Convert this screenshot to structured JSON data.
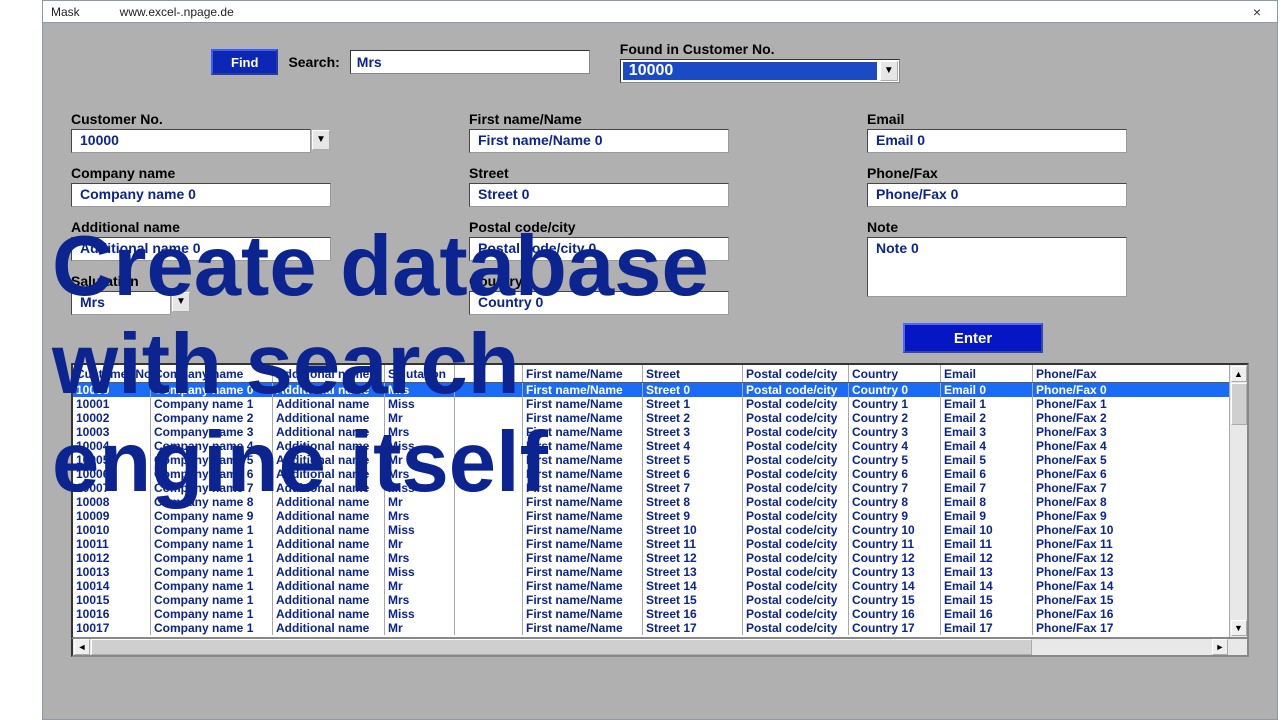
{
  "window": {
    "title": "Mask",
    "url": "www.excel-.npage.de",
    "close_glyph": "×"
  },
  "toolbar": {
    "find_label": "Find",
    "search_label": "Search:",
    "search_value": "Mrs",
    "found_label": "Found in Customer No.",
    "found_value": "10000",
    "enter_label": "Enter"
  },
  "fields": {
    "col1": [
      {
        "label": "Customer No.",
        "value": "10000",
        "combo": true
      },
      {
        "label": "Company name",
        "value": "Company name 0"
      },
      {
        "label": "Additional name",
        "value": "Additional name 0"
      },
      {
        "label": "Salutation",
        "value": "Mrs",
        "narrow": true,
        "combo": true
      }
    ],
    "col2": [
      {
        "label": "First name/Name",
        "value": "First name/Name 0"
      },
      {
        "label": "Street",
        "value": "Street 0"
      },
      {
        "label": "Postal code/city",
        "value": "Postal code/city 0"
      },
      {
        "label": "Country",
        "value": "Country 0"
      }
    ],
    "col3": [
      {
        "label": "Email",
        "value": "Email 0"
      },
      {
        "label": "Phone/Fax",
        "value": "Phone/Fax 0"
      },
      {
        "label": "Note",
        "value": "Note 0",
        "tall": true
      }
    ]
  },
  "list": {
    "headers": [
      "Customer No.",
      "Company name",
      "Additional name",
      "Salutation",
      "",
      "First name/Name",
      "Street",
      "Postal code/city",
      "Country",
      "Email",
      "Phone/Fax"
    ],
    "selected_index": 0,
    "rows": [
      [
        "10000",
        "Company name 0",
        "Additional name",
        "Mrs",
        "",
        "First name/Name",
        "Street 0",
        "Postal code/city",
        "Country 0",
        "Email 0",
        "Phone/Fax 0"
      ],
      [
        "10001",
        "Company name 1",
        "Additional name",
        "Miss",
        "",
        "First name/Name",
        "Street 1",
        "Postal code/city",
        "Country 1",
        "Email 1",
        "Phone/Fax 1"
      ],
      [
        "10002",
        "Company name 2",
        "Additional name",
        "Mr",
        "",
        "First name/Name",
        "Street 2",
        "Postal code/city",
        "Country 2",
        "Email 2",
        "Phone/Fax 2"
      ],
      [
        "10003",
        "Company name 3",
        "Additional name",
        "Mrs",
        "",
        "First name/Name",
        "Street 3",
        "Postal code/city",
        "Country 3",
        "Email 3",
        "Phone/Fax 3"
      ],
      [
        "10004",
        "Company name 4",
        "Additional name",
        "Miss",
        "",
        "First name/Name",
        "Street 4",
        "Postal code/city",
        "Country 4",
        "Email 4",
        "Phone/Fax 4"
      ],
      [
        "10005",
        "Company name 5",
        "Additional name",
        "Mr",
        "",
        "First name/Name",
        "Street 5",
        "Postal code/city",
        "Country 5",
        "Email 5",
        "Phone/Fax 5"
      ],
      [
        "10006",
        "Company name 6",
        "Additional name",
        "Mrs",
        "",
        "First name/Name",
        "Street 6",
        "Postal code/city",
        "Country 6",
        "Email 6",
        "Phone/Fax 6"
      ],
      [
        "10007",
        "Company name 7",
        "Additional name",
        "Miss",
        "",
        "First name/Name",
        "Street 7",
        "Postal code/city",
        "Country 7",
        "Email 7",
        "Phone/Fax 7"
      ],
      [
        "10008",
        "Company name 8",
        "Additional name",
        "Mr",
        "",
        "First name/Name",
        "Street 8",
        "Postal code/city",
        "Country 8",
        "Email 8",
        "Phone/Fax 8"
      ],
      [
        "10009",
        "Company name 9",
        "Additional name",
        "Mrs",
        "",
        "First name/Name",
        "Street 9",
        "Postal code/city",
        "Country 9",
        "Email 9",
        "Phone/Fax 9"
      ],
      [
        "10010",
        "Company name 1",
        "Additional name",
        "Miss",
        "",
        "First name/Name",
        "Street 10",
        "Postal code/city",
        "Country 10",
        "Email 10",
        "Phone/Fax 10"
      ],
      [
        "10011",
        "Company name 1",
        "Additional name",
        "Mr",
        "",
        "First name/Name",
        "Street 11",
        "Postal code/city",
        "Country 11",
        "Email 11",
        "Phone/Fax 11"
      ],
      [
        "10012",
        "Company name 1",
        "Additional name",
        "Mrs",
        "",
        "First name/Name",
        "Street 12",
        "Postal code/city",
        "Country 12",
        "Email 12",
        "Phone/Fax 12"
      ],
      [
        "10013",
        "Company name 1",
        "Additional name",
        "Miss",
        "",
        "First name/Name",
        "Street 13",
        "Postal code/city",
        "Country 13",
        "Email 13",
        "Phone/Fax 13"
      ],
      [
        "10014",
        "Company name 1",
        "Additional name",
        "Mr",
        "",
        "First name/Name",
        "Street 14",
        "Postal code/city",
        "Country 14",
        "Email 14",
        "Phone/Fax 14"
      ],
      [
        "10015",
        "Company name 1",
        "Additional name",
        "Mrs",
        "",
        "First name/Name",
        "Street 15",
        "Postal code/city",
        "Country 15",
        "Email 15",
        "Phone/Fax 15"
      ],
      [
        "10016",
        "Company name 1",
        "Additional name",
        "Miss",
        "",
        "First name/Name",
        "Street 16",
        "Postal code/city",
        "Country 16",
        "Email 16",
        "Phone/Fax 16"
      ],
      [
        "10017",
        "Company name 1",
        "Additional name",
        "Mr",
        "",
        "First name/Name",
        "Street 17",
        "Postal code/city",
        "Country 17",
        "Email 17",
        "Phone/Fax 17"
      ]
    ]
  },
  "overlay_text": "Create database\nwith search\nengine itself"
}
